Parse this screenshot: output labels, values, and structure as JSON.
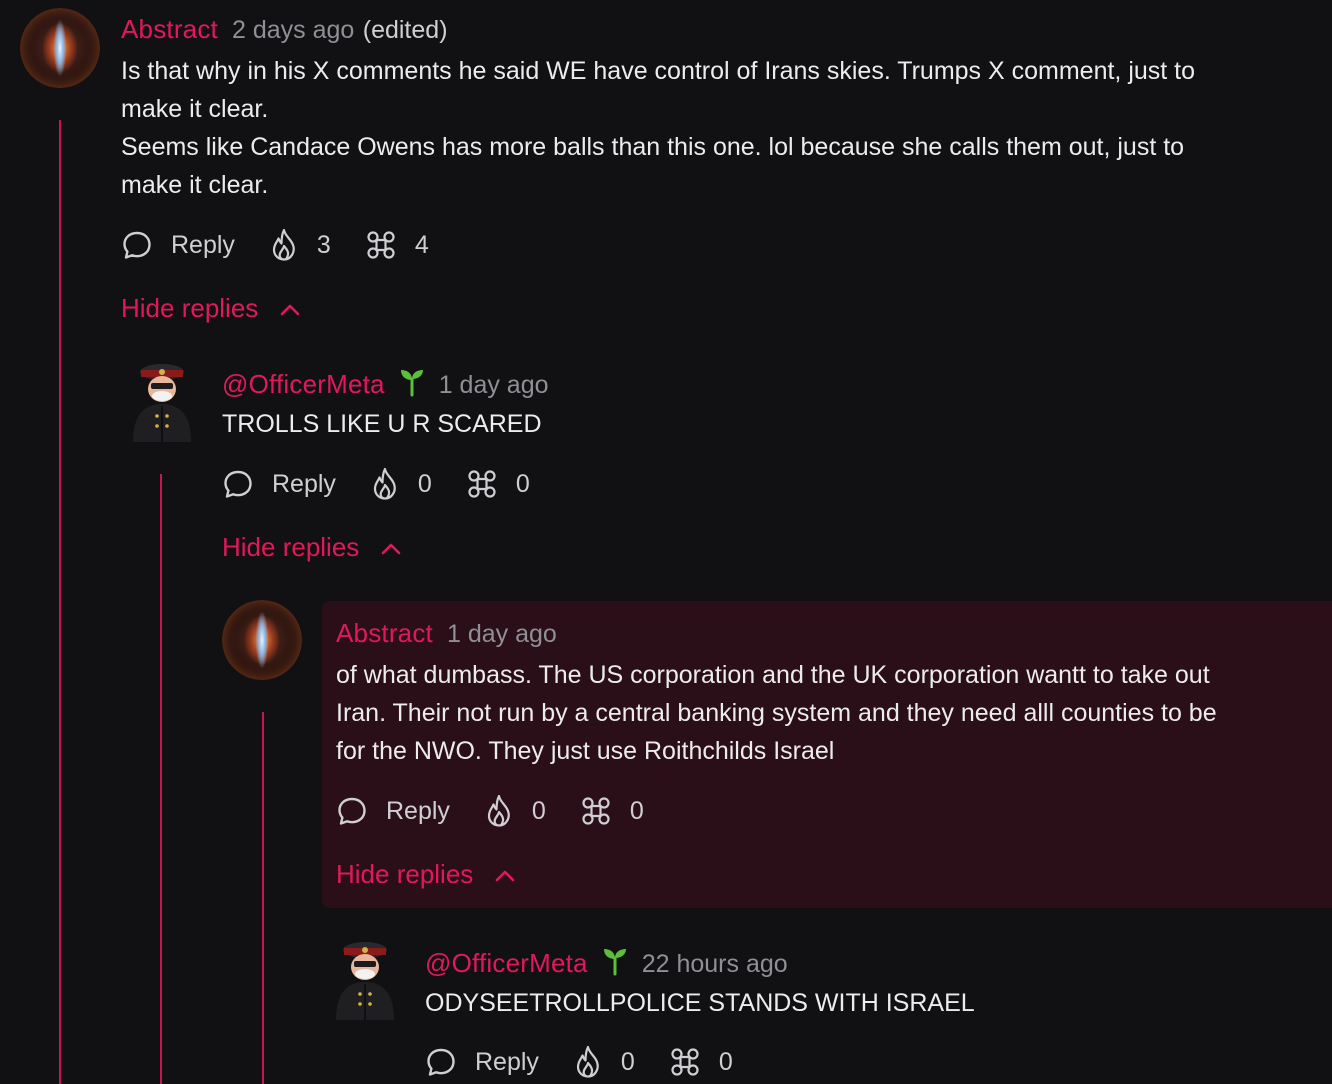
{
  "comments": [
    {
      "author": "Abstract",
      "time": "2 days ago",
      "edited": "(edited)",
      "lines": [
        "Is that why in his X comments he said WE have control of Irans skies. Trumps X comment, just to",
        "make it clear.",
        "Seems like Candace Owens has more balls than this one. lol because she calls them out, just to",
        "make it clear."
      ],
      "reply_label": "Reply",
      "fire_count": "3",
      "slime_count": "4",
      "hide_replies": "Hide replies"
    },
    {
      "author": "@OfficerMeta",
      "time": "1 day ago",
      "lines": [
        "TROLLS LIKE U R SCARED"
      ],
      "reply_label": "Reply",
      "fire_count": "0",
      "slime_count": "0",
      "hide_replies": "Hide replies"
    },
    {
      "author": "Abstract",
      "time": "1 day ago",
      "lines": [
        "of what dumbass. The US corporation and the UK corporation wantt to take out",
        "Iran. Their not run by a central banking system and they need alll counties to be",
        "for the NWO. They just use Roithchilds Israel"
      ],
      "reply_label": "Reply",
      "fire_count": "0",
      "slime_count": "0",
      "hide_replies": "Hide replies"
    },
    {
      "author": "@OfficerMeta",
      "time": "22 hours ago",
      "lines": [
        "ODYSEETROLLPOLICE STANDS WITH ISRAEL"
      ],
      "reply_label": "Reply",
      "fire_count": "0",
      "slime_count": "0"
    }
  ],
  "colors": {
    "accent": "#e2185a",
    "background": "#111113",
    "highlight_bg": "#2a0f18",
    "sprout": "#5cbf3a"
  },
  "icons": {
    "reply": "speech-bubble-icon",
    "fire": "fire-icon",
    "slime": "slimes-icon",
    "hide": "chevron-up-icon",
    "badge": "sprout-icon"
  }
}
